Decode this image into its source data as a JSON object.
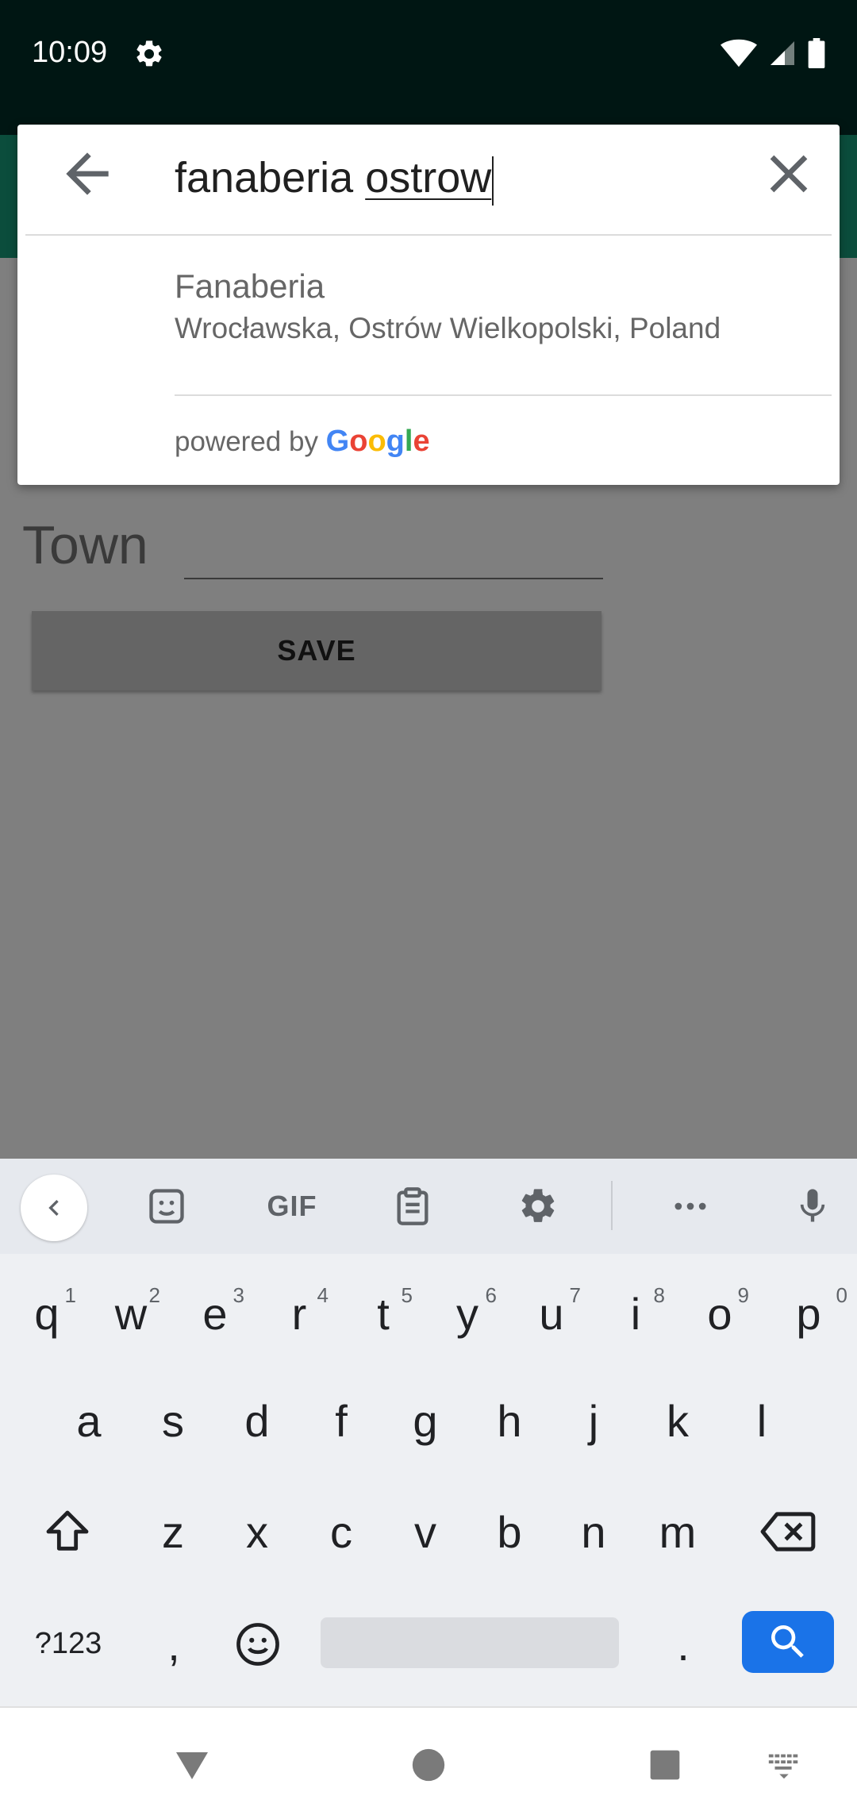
{
  "status_bar": {
    "time": "10:09"
  },
  "search": {
    "query_plain": "fanaberia ",
    "query_composing": "ostrow"
  },
  "results": [
    {
      "title": "Fanaberia",
      "subtitle": "Wrocławska, Ostrów Wielkopolski, Poland"
    }
  ],
  "attribution": {
    "prefix": "powered by ",
    "logo_letters": [
      "G",
      "o",
      "o",
      "g",
      "l",
      "e"
    ],
    "logo_colors": [
      "#4285F4",
      "#EA4335",
      "#FBBC05",
      "#4285F4",
      "#34A853",
      "#EA4335"
    ]
  },
  "form": {
    "town_label": "Town",
    "save_label": "SAVE"
  },
  "keyboard": {
    "toolbar": {
      "gif_label": "GIF"
    },
    "row1": [
      {
        "k": "q",
        "h": "1"
      },
      {
        "k": "w",
        "h": "2"
      },
      {
        "k": "e",
        "h": "3"
      },
      {
        "k": "r",
        "h": "4"
      },
      {
        "k": "t",
        "h": "5"
      },
      {
        "k": "y",
        "h": "6"
      },
      {
        "k": "u",
        "h": "7"
      },
      {
        "k": "i",
        "h": "8"
      },
      {
        "k": "o",
        "h": "9"
      },
      {
        "k": "p",
        "h": "0"
      }
    ],
    "row2": [
      "a",
      "s",
      "d",
      "f",
      "g",
      "h",
      "j",
      "k",
      "l"
    ],
    "row3": [
      "z",
      "x",
      "c",
      "v",
      "b",
      "n",
      "m"
    ],
    "symbols_label": "?123",
    "comma": ",",
    "period": "."
  },
  "colors": {
    "status_bar": "#001613",
    "app_bar": "#0b4d3c",
    "search_key": "#1a73e8"
  }
}
